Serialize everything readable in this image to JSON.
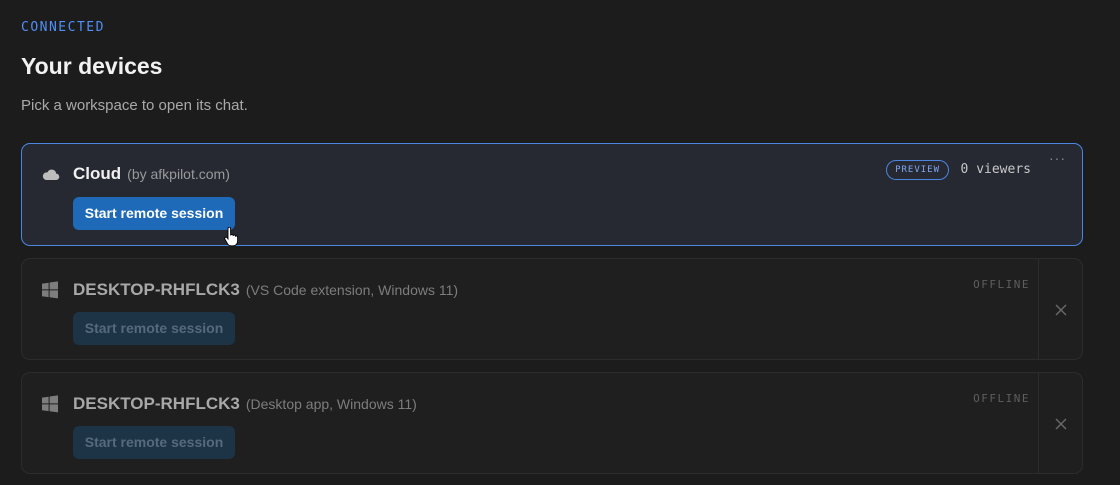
{
  "header": {
    "eyebrow": "CONNECTED",
    "title": "Your devices",
    "subtitle": "Pick a workspace to open its chat."
  },
  "devices": [
    {
      "name": "Cloud",
      "meta": "(by afkpilot.com)",
      "icon": "cloud-icon",
      "badge": "PREVIEW",
      "viewers": "0 viewers",
      "more": "···",
      "button": "Start remote session",
      "state": "active"
    },
    {
      "name": "DESKTOP-RHFLCK3",
      "meta": "(VS Code extension, Windows 11)",
      "icon": "windows-icon",
      "status": "OFFLINE",
      "button": "Start remote session",
      "state": "offline"
    },
    {
      "name": "DESKTOP-RHFLCK3",
      "meta": "(Desktop app, Windows 11)",
      "icon": "windows-icon",
      "status": "OFFLINE",
      "button": "Start remote session",
      "state": "offline"
    }
  ],
  "colors": {
    "accent": "#4f8ff7",
    "primary_button": "#1e6ab8",
    "background": "#1c1c1c",
    "active_card_border": "#4b86e0"
  }
}
